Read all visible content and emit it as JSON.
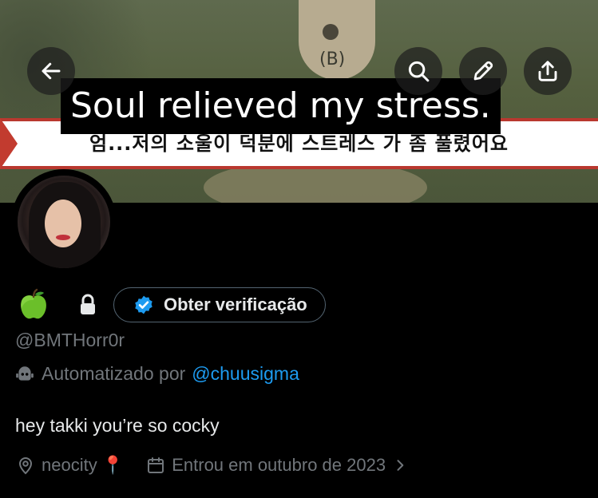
{
  "banner": {
    "caption": "Soul relieved my stress.",
    "korean_subtitle": "엄...저의 소울이 덕분에 스트레스 가 좀 풀렸어요",
    "badge_letter": "(B)"
  },
  "header_buttons": {
    "back_icon": "arrow-left-icon",
    "search_icon": "search-icon",
    "edit_icon": "pencil-icon",
    "share_icon": "share-upload-icon"
  },
  "profile": {
    "name_emoji": "🍏",
    "protected": true,
    "verify_button_label": "Obter verificação",
    "handle": "@BMTHorr0r",
    "automated_prefix": "Automatizado por",
    "automated_by": "@chuusigma",
    "bio": "hey takki you’re so cocky",
    "location": "neocity 📍",
    "joined": "Entrou em outubro de 2023"
  },
  "colors": {
    "background": "#000000",
    "text_primary": "#e7e9ea",
    "text_secondary": "#71767b",
    "link": "#1d9bf0",
    "verified_badge": "#1d9bf0"
  }
}
